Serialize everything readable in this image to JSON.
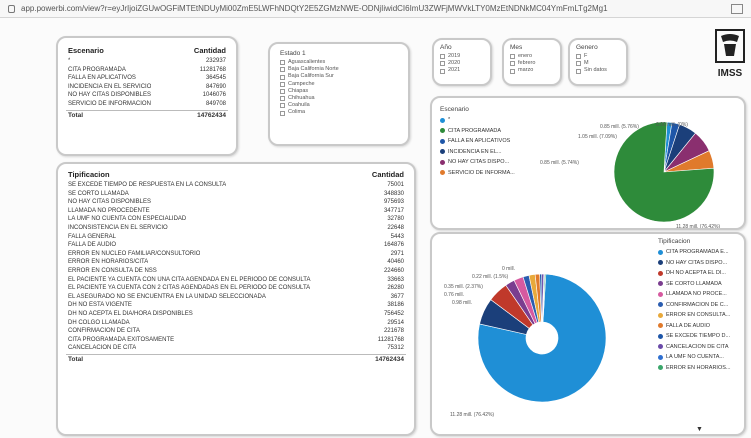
{
  "browser": {
    "url": "app.powerbi.com/view?r=eyJrIjoiZGUwOGFiMTEtNDUyMi00ZmE5LWFhNDQtY2E5ZGMzNWE-ODNjIiwidCI6ImU3ZWFjMWVkLTY0MzEtNDNkMC04YmFmLTg2Mg1"
  },
  "logo": {
    "text": "IMSS"
  },
  "escenario_table": {
    "headers": [
      "Escenario",
      "Cantidad"
    ],
    "rows": [
      [
        "*",
        "232937"
      ],
      [
        "CITA PROGRAMADA",
        "11281768"
      ],
      [
        "FALLA EN APLICATIVOS",
        "364545"
      ],
      [
        "INCIDENCIA EN EL SERVICIO",
        "847690"
      ],
      [
        "NO HAY CITAS DISPONIBLES",
        "1046076"
      ],
      [
        "SERVICIO DE INFORMACION",
        "849708"
      ]
    ],
    "total": [
      "Total",
      "14762434"
    ]
  },
  "estado_slicer": {
    "title": "Estado 1",
    "items": [
      "Aguascalientes",
      "Baja California Norte",
      "Baja California Sur",
      "Campeche",
      "Chiapas",
      "Chihuahua",
      "Coahuila",
      "Colima"
    ]
  },
  "anio_slicer": {
    "title": "Año",
    "items": [
      "2019",
      "2020",
      "2021"
    ]
  },
  "mes_slicer": {
    "title": "Mes",
    "items": [
      "enero",
      "febrero",
      "marzo"
    ]
  },
  "genero_slicer": {
    "title": "Genero",
    "items": [
      "F",
      "M",
      "Sin datos"
    ]
  },
  "escenario_pie": {
    "legend_title": "Escenario",
    "legend": [
      {
        "label": "*",
        "color": "#1f8fd6"
      },
      {
        "label": "CITA PROGRAMADA",
        "color": "#2e8b3a"
      },
      {
        "label": "FALLA EN APLICATIVOS",
        "color": "#1e56a8"
      },
      {
        "label": "INCIDENCIA EN EL...",
        "color": "#1b3f7a"
      },
      {
        "label": "NO HAY CITAS DISPO...",
        "color": "#8a2f6f"
      },
      {
        "label": "SERVICIO DE INFORMA...",
        "color": "#e07a2c"
      }
    ],
    "labels": [
      "0.85 mill. (5.76%)",
      "1.05 mill. (7.09%)",
      "0.00 mill. (0%)",
      "0.85 mill. (5.74%)",
      "11.28 mill. (76.42%)"
    ]
  },
  "tipificacion_table": {
    "headers": [
      "Tipificacion",
      "Cantidad"
    ],
    "rows": [
      [
        "SE EXCEDE TIEMPO DE RESPUESTA EN LA CONSULTA",
        "75001"
      ],
      [
        "SE CORTO LLAMADA",
        "348830"
      ],
      [
        "NO HAY CITAS DISPONIBLES",
        "975693"
      ],
      [
        "LLAMADA NO PROCEDENTE",
        "347717"
      ],
      [
        "LA UMF NO CUENTA CON ESPECIALIDAD",
        "32780"
      ],
      [
        "INCONSISTENCIA EN EL SERVICIO",
        "22648"
      ],
      [
        "FALLA GENERAL",
        "5443"
      ],
      [
        "FALLA DE AUDIO",
        "164876"
      ],
      [
        "ERROR EN NUCLEO FAMILIAR/CONSULTORIO",
        "2971"
      ],
      [
        "ERROR EN HORARIOS/CITA",
        "40460"
      ],
      [
        "ERROR EN CONSULTA DE NSS",
        "224660"
      ],
      [
        "EL PACIENTE YA CUENTA CON UNA CITA AGENDADA EN EL PERIODO DE CONSULTA",
        "33663"
      ],
      [
        "EL PACIENTE YA CUENTA CON 2 CITAS AGENDADAS EN EL PERIODO DE CONSULTA",
        "26280"
      ],
      [
        "EL ASEGURADO NO SE ENCUENTRA EN LA UNIDAD SELECCIONADA",
        "3677"
      ],
      [
        "DH NO ESTA VIGENTE",
        "38186"
      ],
      [
        "DH NO ACEPTA EL DIA/HORA DISPONIBLES",
        "756452"
      ],
      [
        "DH COLGO LLAMADA",
        "29514"
      ],
      [
        "CONFIRMACION DE CITA",
        "221678"
      ],
      [
        "CITA PROGRAMADA EXITOSAMENTE",
        "11281768"
      ],
      [
        "CANCELACION DE CITA",
        "75312"
      ]
    ],
    "total": [
      "Total",
      "14762434"
    ]
  },
  "tipificacion_pie": {
    "legend_title": "Tipificacion",
    "legend": [
      {
        "label": "CITA PROGRAMADA E...",
        "color": "#1f8fd6"
      },
      {
        "label": "NO HAY CITAS DISPO...",
        "color": "#1b3f7a"
      },
      {
        "label": "DH NO ACEPTA EL DI...",
        "color": "#c0392b"
      },
      {
        "label": "SE CORTO LLAMADA",
        "color": "#7a3d8f"
      },
      {
        "label": "LLAMADA NO PROCE...",
        "color": "#d65aa0"
      },
      {
        "label": "CONFIRMACION DE C...",
        "color": "#2a5db0"
      },
      {
        "label": "ERROR EN CONSULTA...",
        "color": "#e8a93b"
      },
      {
        "label": "FALLA DE AUDIO",
        "color": "#e07a2c"
      },
      {
        "label": "SE EXCEDE TIEMPO D...",
        "color": "#1e56a8"
      },
      {
        "label": "CANCELACION DE CITA",
        "color": "#6a4aa8"
      },
      {
        "label": "LA UMF NO CUENTA...",
        "color": "#2f6fd0"
      },
      {
        "label": "ERROR EN HORARIOS...",
        "color": "#3aa66a"
      }
    ],
    "labels": [
      "0 mill.",
      "0.22 mill. (1.5%)",
      "0.35 mill. (2.37%)",
      "0.76 mill.",
      "0.98 mill.",
      "11.28 mill. (76.42%)"
    ]
  }
}
